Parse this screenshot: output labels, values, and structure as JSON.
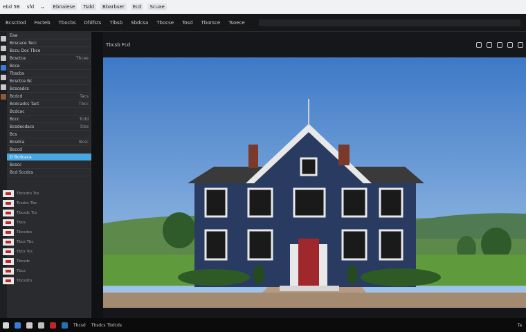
{
  "titlebar": {
    "items": [
      "ebd 5B",
      "sfd",
      "ᴗ"
    ],
    "labels": [
      "Ebnaiese",
      "Tsdd",
      "Bbarbser",
      "Ecd",
      "Scuae"
    ]
  },
  "toolbar": {
    "items": [
      "Bcsctlod",
      "Facteb",
      "Tbocbs",
      "Dfdfsts",
      "Tlbsb",
      "Sbdcsa",
      "Tbocse",
      "Tosd",
      "Tborsce",
      "Tsoece"
    ]
  },
  "sidebar": {
    "header": "Eaa",
    "rows": [
      {
        "label": "Bcscace Tecc",
        "value": ""
      },
      {
        "label": "Bccu Doc Tbce",
        "value": ""
      },
      {
        "label": "Bcsctce",
        "value": "Tbcee"
      },
      {
        "label": "Bcce",
        "value": ""
      },
      {
        "label": "Tbscbs",
        "value": ""
      },
      {
        "label": "Bcsctce Bc",
        "value": ""
      },
      {
        "label": "Bcscedcs",
        "value": ""
      },
      {
        "label": "Bcdcd",
        "value": "Tacs"
      },
      {
        "label": "Bcdcadcs Tact",
        "value": "Tbcc"
      },
      {
        "label": "Bcdcac",
        "value": ""
      },
      {
        "label": "Bccc",
        "value": "Tcdd"
      },
      {
        "label": "Bcsdecdacs",
        "value": "Tcbs"
      },
      {
        "label": "Bcs",
        "value": ""
      },
      {
        "label": "Bcsdca",
        "value": "Bcsc"
      },
      {
        "label": "Bcccd",
        "value": ""
      }
    ],
    "selected": "D Bcdcaca",
    "sub_header": "Bcscc",
    "list_header": "Bcd Sccdcs",
    "thumbs": [
      "Tbcsdcs  Tcs",
      "Tcsdcs Tbc",
      "Tbcsdc Tcs",
      "Tbcs",
      "Tbcsdcs",
      "Tbcs Tbc",
      "Tbcs Tcs",
      "Tbcsdc",
      "Tbcs",
      "Tbcsdcs"
    ]
  },
  "viewer": {
    "title": "Tbcsb Fcd",
    "icons": [
      "panel-icon",
      "tag-icon",
      "settings-icon",
      "view-icon",
      "grid-icon"
    ]
  },
  "photo": {
    "subject": "house"
  },
  "status": {
    "items": [
      "Tbcsd",
      "Tbsdcs Tbdcds"
    ],
    "right": "Ta"
  },
  "colors": {
    "accent": "#48a6e0",
    "wall": "#2a3b62",
    "door": "#a0282c",
    "sky": "#4d8bd4"
  }
}
